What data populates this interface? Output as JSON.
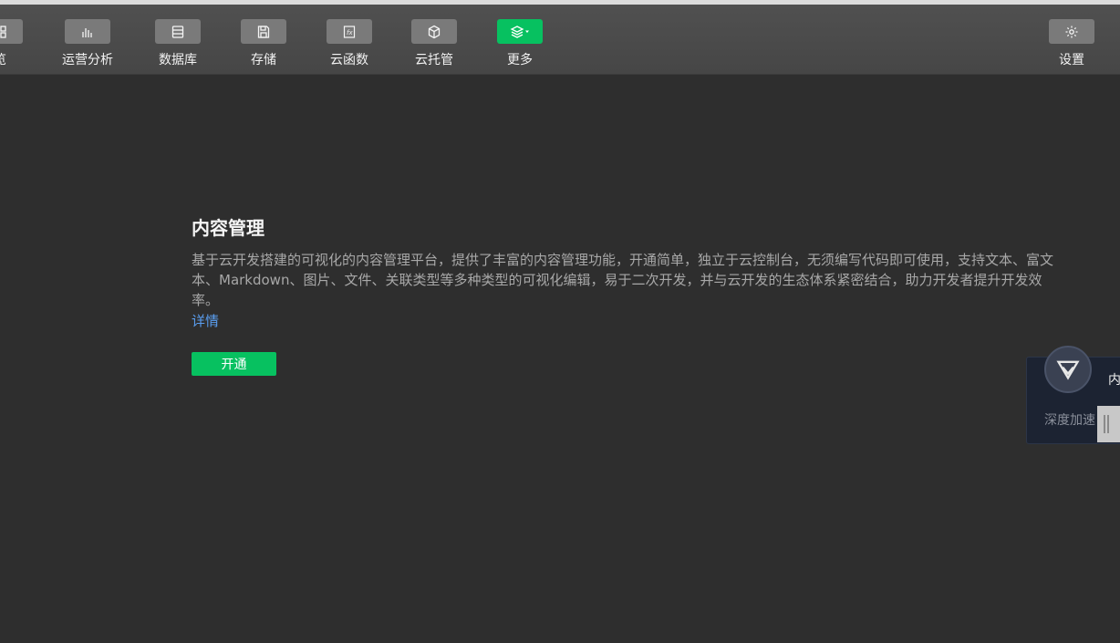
{
  "toolbar": {
    "items": [
      {
        "label": "览",
        "icon": "grid-icon"
      },
      {
        "label": "运营分析",
        "icon": "bar-chart-icon"
      },
      {
        "label": "数据库",
        "icon": "database-icon"
      },
      {
        "label": "存储",
        "icon": "save-icon"
      },
      {
        "label": "云函数",
        "icon": "function-icon"
      },
      {
        "label": "云托管",
        "icon": "cube-icon"
      },
      {
        "label": "更多",
        "icon": "layers-icon"
      },
      {
        "label": "设置",
        "icon": "gear-icon"
      }
    ],
    "accent": "#07c160"
  },
  "main": {
    "title": "内容管理",
    "description": "基于云开发搭建的可视化的内容管理平台，提供了丰富的内容管理功能，开通简单，独立于云控制台，无须编写代码即可使用，支持文本、富文本、Markdown、图片、文件、关联类型等多种类型的可视化编辑，易于二次开发，并与云开发的生态体系紧密结合，助力开发者提升开发效率。",
    "detail_link": "详情",
    "open_button": "开通"
  },
  "float_panel": {
    "title": "内",
    "subtitle": "深度加速",
    "icon": "shield-check-icon"
  }
}
